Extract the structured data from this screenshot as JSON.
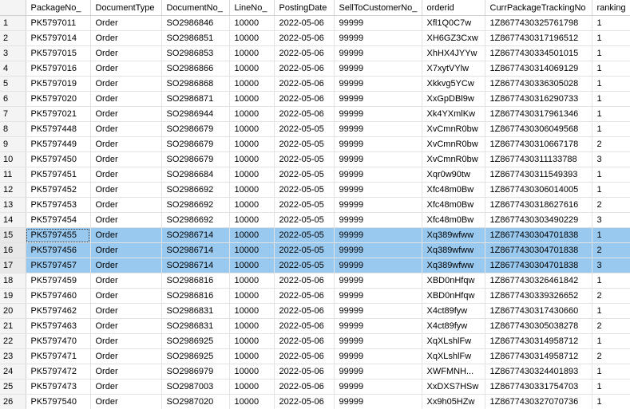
{
  "grid": {
    "columns": [
      "PackageNo_",
      "DocumentType",
      "DocumentNo_",
      "LineNo_",
      "PostingDate",
      "SellToCustomerNo_",
      "orderid",
      "CurrPackageTrackingNo",
      "ranking"
    ],
    "rows": [
      {
        "n": "1",
        "cells": [
          "PK5797011",
          "Order",
          "SO2986846",
          "10000",
          "2022-05-06",
          "99999",
          "Xfl1Q0C7w",
          "1Z8677430325761798",
          "1"
        ]
      },
      {
        "n": "2",
        "cells": [
          "PK5797014",
          "Order",
          "SO2986851",
          "10000",
          "2022-05-06",
          "99999",
          "XH6GZ3Cxw",
          "1Z8677430317196512",
          "1"
        ]
      },
      {
        "n": "3",
        "cells": [
          "PK5797015",
          "Order",
          "SO2986853",
          "10000",
          "2022-05-06",
          "99999",
          "XhHX4JYYw",
          "1Z8677430334501015",
          "1"
        ]
      },
      {
        "n": "4",
        "cells": [
          "PK5797016",
          "Order",
          "SO2986866",
          "10000",
          "2022-05-06",
          "99999",
          "X7xytVYlw",
          "1Z8677430314069129",
          "1"
        ]
      },
      {
        "n": "5",
        "cells": [
          "PK5797019",
          "Order",
          "SO2986868",
          "10000",
          "2022-05-06",
          "99999",
          "Xkkvg5YCw",
          "1Z8677430336305028",
          "1"
        ]
      },
      {
        "n": "6",
        "cells": [
          "PK5797020",
          "Order",
          "SO2986871",
          "10000",
          "2022-05-06",
          "99999",
          "XxGpDBl9w",
          "1Z8677430316290733",
          "1"
        ]
      },
      {
        "n": "7",
        "cells": [
          "PK5797021",
          "Order",
          "SO2986944",
          "10000",
          "2022-05-06",
          "99999",
          "Xk4YXmlKw",
          "1Z8677430317961346",
          "1"
        ]
      },
      {
        "n": "8",
        "cells": [
          "PK5797448",
          "Order",
          "SO2986679",
          "10000",
          "2022-05-05",
          "99999",
          "XvCmnR0bw",
          "1Z8677430306049568",
          "1"
        ]
      },
      {
        "n": "9",
        "cells": [
          "PK5797449",
          "Order",
          "SO2986679",
          "10000",
          "2022-05-05",
          "99999",
          "XvCmnR0bw",
          "1Z8677430310667178",
          "2"
        ]
      },
      {
        "n": "10",
        "cells": [
          "PK5797450",
          "Order",
          "SO2986679",
          "10000",
          "2022-05-05",
          "99999",
          "XvCmnR0bw",
          "1Z8677430311133788",
          "3"
        ]
      },
      {
        "n": "11",
        "cells": [
          "PK5797451",
          "Order",
          "SO2986684",
          "10000",
          "2022-05-05",
          "99999",
          "Xqr0w90tw",
          "1Z8677430311549393",
          "1"
        ]
      },
      {
        "n": "12",
        "cells": [
          "PK5797452",
          "Order",
          "SO2986692",
          "10000",
          "2022-05-05",
          "99999",
          "Xfc48m0Bw",
          "1Z8677430306014005",
          "1"
        ]
      },
      {
        "n": "13",
        "cells": [
          "PK5797453",
          "Order",
          "SO2986692",
          "10000",
          "2022-05-05",
          "99999",
          "Xfc48m0Bw",
          "1Z8677430318627616",
          "2"
        ]
      },
      {
        "n": "14",
        "cells": [
          "PK5797454",
          "Order",
          "SO2986692",
          "10000",
          "2022-05-05",
          "99999",
          "Xfc48m0Bw",
          "1Z8677430303490229",
          "3"
        ]
      },
      {
        "n": "15",
        "selected": true,
        "cells": [
          "PK5797455",
          "Order",
          "SO2986714",
          "10000",
          "2022-05-05",
          "99999",
          "Xq389wfww",
          "1Z8677430304701838",
          "1"
        ]
      },
      {
        "n": "16",
        "selected": true,
        "cells": [
          "PK5797456",
          "Order",
          "SO2986714",
          "10000",
          "2022-05-05",
          "99999",
          "Xq389wfww",
          "1Z8677430304701838",
          "2"
        ]
      },
      {
        "n": "17",
        "selected": true,
        "cells": [
          "PK5797457",
          "Order",
          "SO2986714",
          "10000",
          "2022-05-05",
          "99999",
          "Xq389wfww",
          "1Z8677430304701838",
          "3"
        ]
      },
      {
        "n": "18",
        "cells": [
          "PK5797459",
          "Order",
          "SO2986816",
          "10000",
          "2022-05-06",
          "99999",
          "XBD0nHfqw",
          "1Z8677430326461842",
          "1"
        ]
      },
      {
        "n": "19",
        "cells": [
          "PK5797460",
          "Order",
          "SO2986816",
          "10000",
          "2022-05-06",
          "99999",
          "XBD0nHfqw",
          "1Z8677430339326652",
          "2"
        ]
      },
      {
        "n": "20",
        "cells": [
          "PK5797462",
          "Order",
          "SO2986831",
          "10000",
          "2022-05-06",
          "99999",
          "X4ct89fyw",
          "1Z8677430317430660",
          "1"
        ]
      },
      {
        "n": "21",
        "cells": [
          "PK5797463",
          "Order",
          "SO2986831",
          "10000",
          "2022-05-06",
          "99999",
          "X4ct89fyw",
          "1Z8677430305038278",
          "2"
        ]
      },
      {
        "n": "22",
        "cells": [
          "PK5797470",
          "Order",
          "SO2986925",
          "10000",
          "2022-05-06",
          "99999",
          "XqXLshlFw",
          "1Z8677430314958712",
          "1"
        ]
      },
      {
        "n": "23",
        "cells": [
          "PK5797471",
          "Order",
          "SO2986925",
          "10000",
          "2022-05-06",
          "99999",
          "XqXLshlFw",
          "1Z8677430314958712",
          "2"
        ]
      },
      {
        "n": "24",
        "cells": [
          "PK5797472",
          "Order",
          "SO2986979",
          "10000",
          "2022-05-06",
          "99999",
          "XWFMNH...",
          "1Z8677430324401893",
          "1"
        ]
      },
      {
        "n": "25",
        "cells": [
          "PK5797473",
          "Order",
          "SO2987003",
          "10000",
          "2022-05-06",
          "99999",
          "XxDXS7HSw",
          "1Z8677430331754703",
          "1"
        ]
      },
      {
        "n": "26",
        "cells": [
          "PK5797540",
          "Order",
          "SO2987020",
          "10000",
          "2022-05-06",
          "99999",
          "Xx9h05HZw",
          "1Z8677430327070736",
          "1"
        ]
      }
    ]
  },
  "colors": {
    "selection": "#99c9ef",
    "row_header": "#f4f4f4",
    "gridline": "#e3e3e3"
  }
}
